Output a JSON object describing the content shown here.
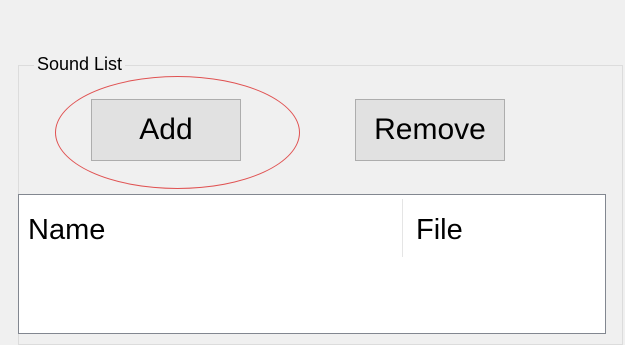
{
  "group": {
    "title": "Sound List"
  },
  "buttons": {
    "add_label": "Add",
    "remove_label": "Remove"
  },
  "list": {
    "columns": [
      "Name",
      "File"
    ]
  },
  "colors": {
    "highlight": "#e05252",
    "background": "#f0f0f0",
    "button_face": "#e1e1e1"
  }
}
